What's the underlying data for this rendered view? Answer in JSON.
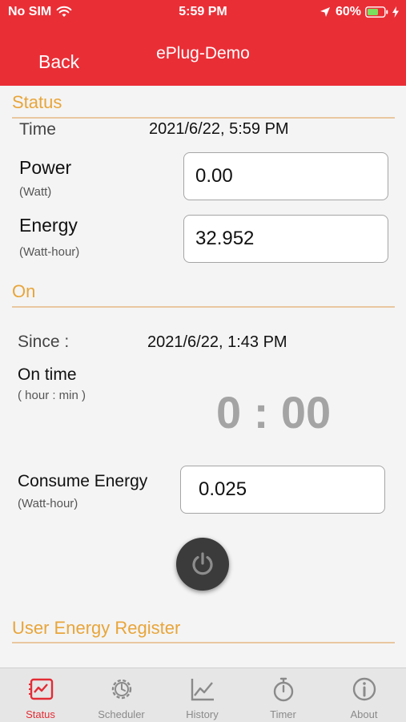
{
  "status_bar": {
    "carrier": "No SIM",
    "time": "5:59 PM",
    "battery": "60%"
  },
  "nav": {
    "back": "Back",
    "title": "ePlug-Demo"
  },
  "status": {
    "heading": "Status",
    "time_label": "Time",
    "time_value": "2021/6/22, 5:59 PM",
    "power_label": "Power",
    "power_unit": "(Watt)",
    "power_value": "0.00",
    "energy_label": "Energy",
    "energy_unit": "(Watt-hour)",
    "energy_value": "32.952"
  },
  "on": {
    "heading": "On",
    "since_label": "Since :",
    "since_value": "2021/6/22, 1:43 PM",
    "on_time_label": "On time",
    "on_time_unit": "( hour : min )",
    "on_time_value": "0 : 00",
    "consume_label": "Consume Energy",
    "consume_unit": "(Watt-hour)",
    "consume_value": "0.025"
  },
  "register": {
    "heading": "User Energy Register"
  },
  "tabs": [
    {
      "label": "Status",
      "icon": "status-icon",
      "active": true
    },
    {
      "label": "Scheduler",
      "icon": "gear-icon",
      "active": false
    },
    {
      "label": "History",
      "icon": "chart-icon",
      "active": false
    },
    {
      "label": "Timer",
      "icon": "stopwatch-icon",
      "active": false
    },
    {
      "label": "About",
      "icon": "info-icon",
      "active": false
    }
  ],
  "colors": {
    "header": "#ea2e36",
    "accent": "#e8a53a",
    "tab_active": "#e32c34",
    "tab_inactive": "#8a8a8a"
  }
}
